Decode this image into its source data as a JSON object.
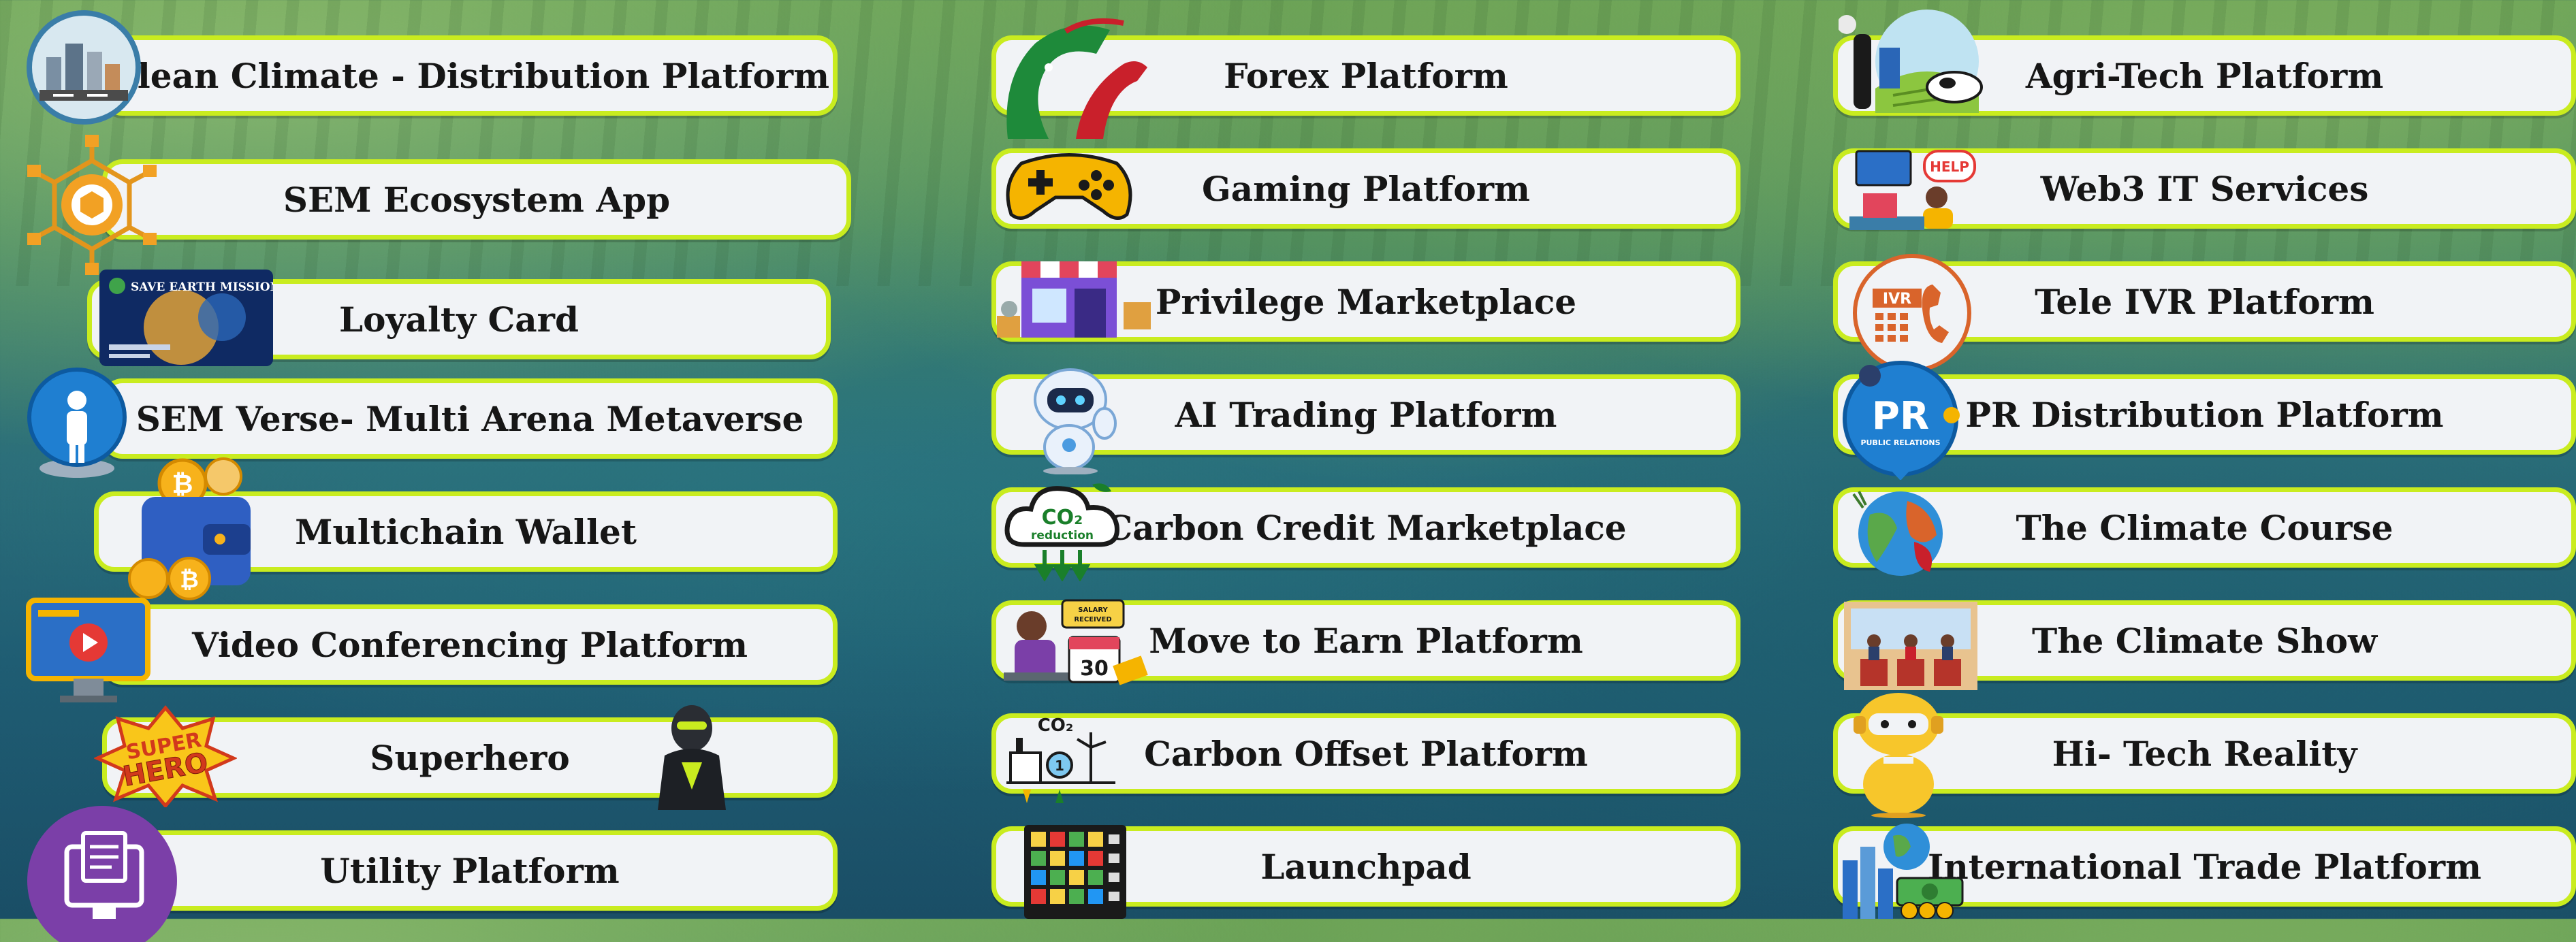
{
  "colors": {
    "pill_border": "#c9ec1f",
    "pill_fill": "#f1f3f6",
    "text": "#161616"
  },
  "columns": [
    {
      "items": [
        {
          "label": "Clean Climate - Distribution Platform",
          "icon": "city-globe-icon"
        },
        {
          "label": "SEM Ecosystem App",
          "icon": "blockchain-hexagon-icon"
        },
        {
          "label": "Loyalty Card",
          "icon": "save-earth-card-icon"
        },
        {
          "label": "SEM Verse- Multi Arena Metaverse",
          "icon": "metaverse-avatar-icon"
        },
        {
          "label": "Multichain Wallet",
          "icon": "crypto-wallet-icon"
        },
        {
          "label": "Video Conferencing Platform",
          "icon": "video-monitor-icon"
        },
        {
          "label": "Superhero",
          "icon": "superhero-badge-icon"
        },
        {
          "label": "Utility Platform",
          "icon": "utility-document-icon"
        }
      ]
    },
    {
      "items": [
        {
          "label": "Forex Platform",
          "icon": "bull-bear-icon"
        },
        {
          "label": "Gaming Platform",
          "icon": "gamepad-icon"
        },
        {
          "label": "Privilege Marketplace",
          "icon": "storefront-icon"
        },
        {
          "label": "AI Trading Platform",
          "icon": "robot-icon"
        },
        {
          "label": "Carbon Credit Marketplace",
          "icon": "co2-cloud-icon"
        },
        {
          "label": "Move to Earn Platform",
          "icon": "salary-calendar-icon"
        },
        {
          "label": "Carbon Offset Platform",
          "icon": "co2-factory-icon"
        },
        {
          "label": "Launchpad",
          "icon": "launchpad-grid-icon"
        }
      ]
    },
    {
      "items": [
        {
          "label": "Agri-Tech Platform",
          "icon": "farm-cow-icon"
        },
        {
          "label": "Web3 IT Services",
          "icon": "help-desk-icon"
        },
        {
          "label": "Tele IVR Platform",
          "icon": "ivr-phone-icon"
        },
        {
          "label": "PR Distribution Platform",
          "icon": "pr-badge-icon"
        },
        {
          "label": "The Climate Course",
          "icon": "earth-head-icon"
        },
        {
          "label": "The Climate Show",
          "icon": "tv-studio-icon"
        },
        {
          "label": "Hi- Tech Reality",
          "icon": "yellow-robot-icon"
        },
        {
          "label": "International Trade Platform",
          "icon": "trade-globe-money-icon"
        }
      ]
    }
  ],
  "icon_text": {
    "loyalty_card_title": "SAVE EARTH MISSION",
    "superhero_badge": "SUPER HERO",
    "co2": "CO₂",
    "co2_reduction": "reduction",
    "calendar_day": "30",
    "salary": "SALARY RECEIVED",
    "ivr": "IVR",
    "help": "HELP",
    "pr": "PR",
    "pr_sub": "PUBLIC RELATIONS"
  }
}
